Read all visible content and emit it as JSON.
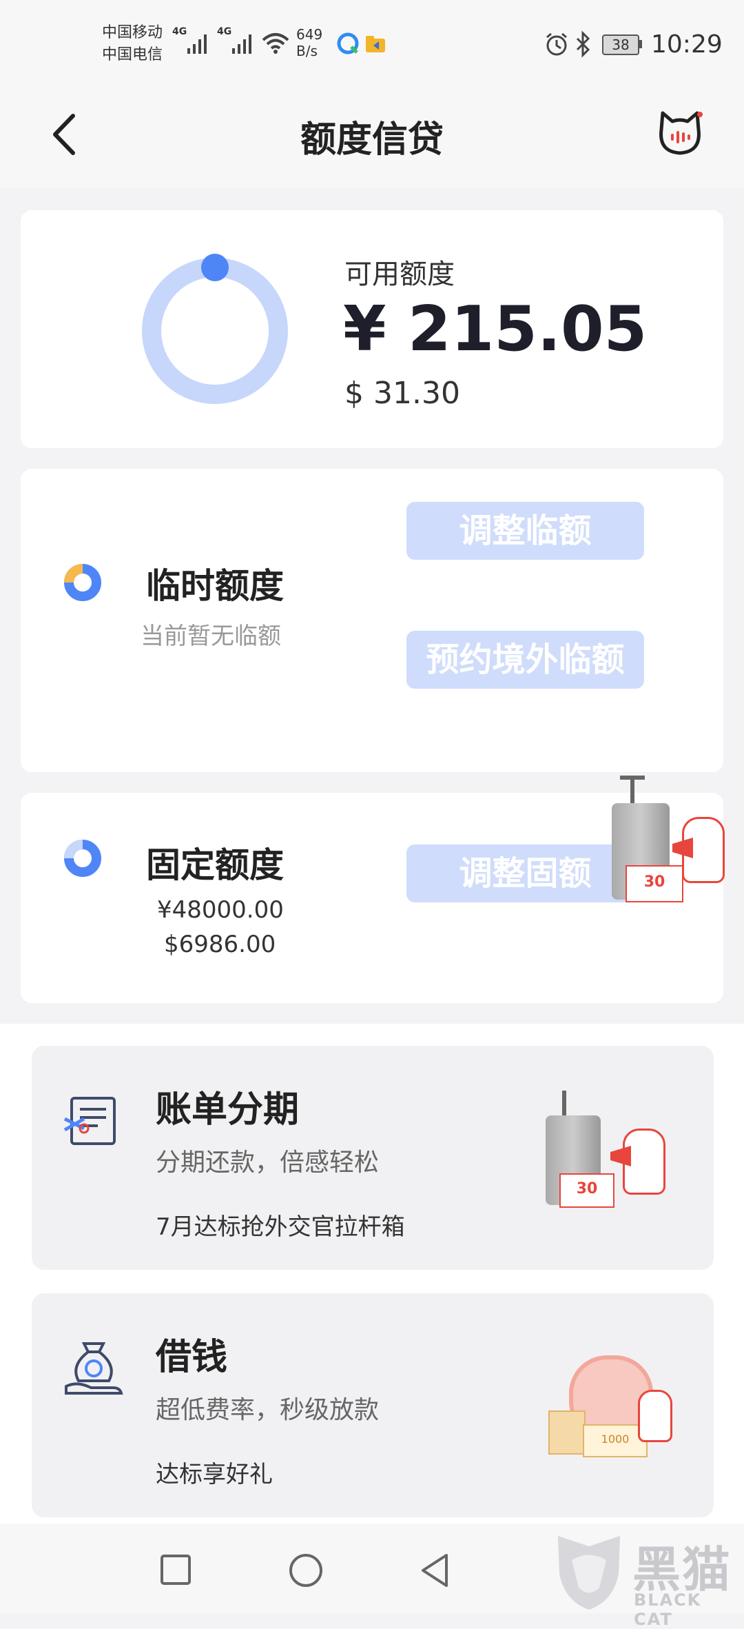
{
  "status": {
    "carrier1": "中国移动",
    "carrier2": "中国电信",
    "net1": "4G",
    "net2": "4G",
    "speed_value": "649",
    "speed_unit": "B/s",
    "battery": "38",
    "time": "10:29"
  },
  "header": {
    "title": "额度信贷"
  },
  "available": {
    "label": "可用额度",
    "cny": "¥ 215.05",
    "usd": "$ 31.30"
  },
  "temp_limit": {
    "title": "临时额度",
    "subtitle": "当前暂无临额",
    "adjust_btn": "调整临额",
    "overseas_btn": "预约境外临额"
  },
  "fixed_limit": {
    "title": "固定额度",
    "cny": "¥48000.00",
    "usd": "$6986.00",
    "adjust_btn": "调整固额",
    "promo_badge": "30"
  },
  "installment": {
    "title": "账单分期",
    "subtitle": "分期还款，倍感轻松",
    "promo": "7月达标抢外交官拉杆箱",
    "promo_badge": "30"
  },
  "loan": {
    "title": "借钱",
    "subtitle": "超低费率，秒级放款",
    "promo": "达标享好礼",
    "coupon_value": "1000"
  },
  "watermark": {
    "cn": "黑猫",
    "en": "BLACK CAT"
  },
  "colors": {
    "accent_blue": "#4f86f7",
    "light_blue": "#c6d7fb",
    "orange": "#f5b94e",
    "promo_red": "#e8453c"
  }
}
